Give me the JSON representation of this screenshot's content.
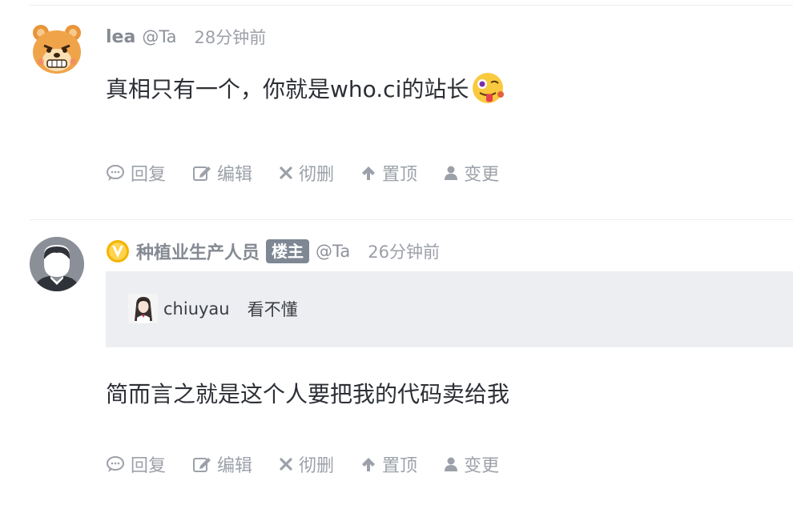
{
  "comments": [
    {
      "name": "lea",
      "handle": "@Ta",
      "time": "28分钟前",
      "text": "真相只有一个，你就是who.ci的站长",
      "emoji": "face-with-tongue-emoji"
    },
    {
      "name": "种植业生产人员",
      "badge": "楼主",
      "handle": "@Ta",
      "time": "26分钟前",
      "quote": {
        "user": "chiuyau",
        "text": "看不懂"
      },
      "text": "简而言之就是这个人要把我的代码卖给我"
    }
  ],
  "actions": {
    "reply": "回复",
    "edit": "编辑",
    "delete": "彻删",
    "pin": "置顶",
    "change": "变更"
  },
  "colors": {
    "action_gray": "#9ca1a9",
    "badge_bg": "#7e8793",
    "quote_bg": "#eceef1",
    "verified_yellow": "#f4b400"
  },
  "icons": [
    "bear-avatar",
    "default-user-avatar",
    "verified-v-icon",
    "comment-icon",
    "edit-icon",
    "close-icon",
    "arrow-up-icon",
    "user-icon"
  ]
}
